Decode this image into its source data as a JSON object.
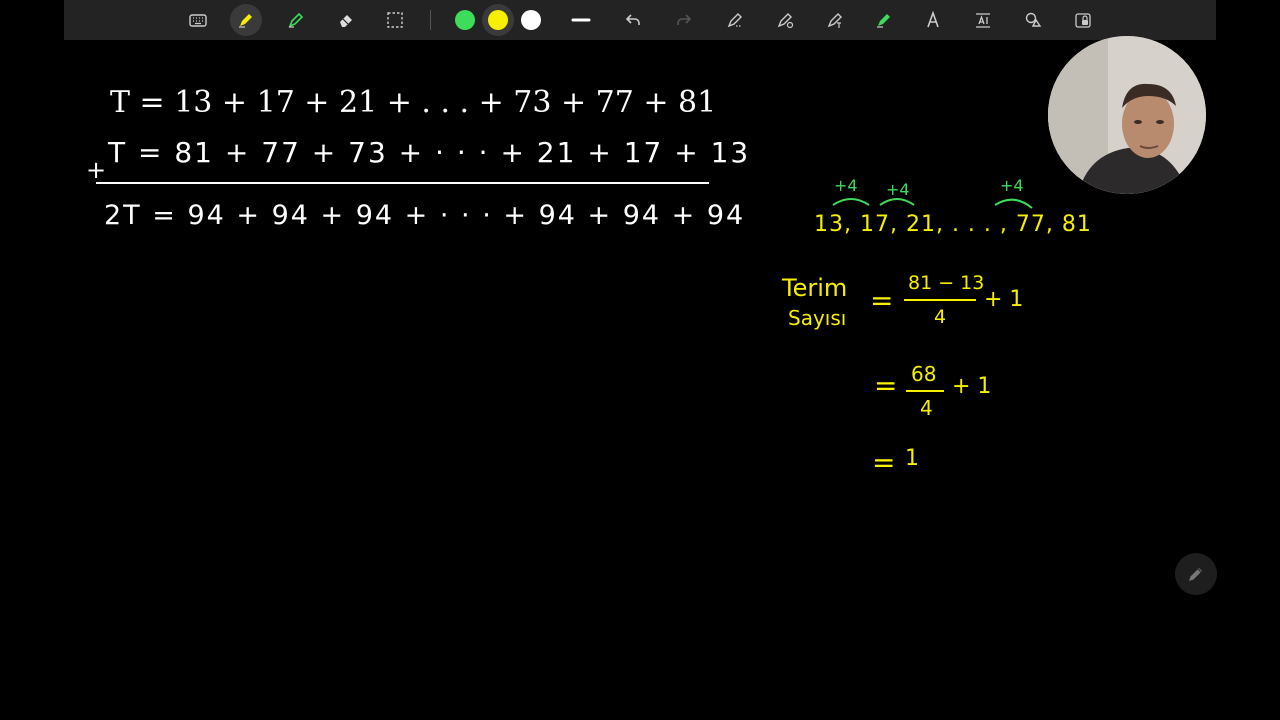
{
  "toolbar": {
    "tools": [
      "keyboard",
      "pen",
      "highlighter",
      "eraser",
      "lasso"
    ],
    "colors": [
      "#3ddc5a",
      "#f6f000",
      "#ffffff"
    ],
    "selected_color": "#f6f000"
  },
  "canvas": {
    "sum_forward": "T = 13 + 17 + 21 + . . . + 73 + 77 + 81",
    "sum_reverse": "T = 81 + 77 + 73 + · · · + 21 + 17 + 13",
    "plus_sign": "+",
    "sum_total": "2T = 94 + 94 + 94 + · · · + 94 + 94 + 94",
    "sequence": "13, 17, 21, . . . , 77, 81",
    "step_labels": [
      "+4",
      "+4",
      "+4"
    ],
    "term_label_1": "Terim",
    "term_label_2": "Sayısı",
    "eq_sign": "=",
    "frac1_num": "81 − 13",
    "frac1_den": "4",
    "plus_one": "+ 1",
    "frac2_num": "68",
    "frac2_den": "4",
    "result_partial": "1"
  }
}
